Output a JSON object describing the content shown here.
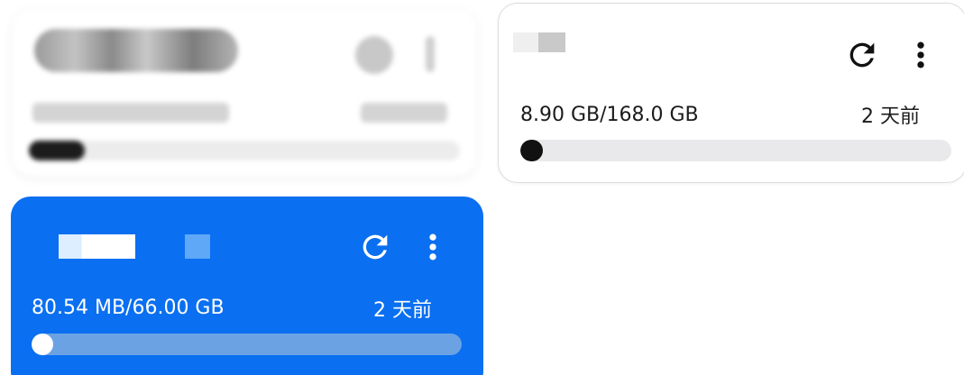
{
  "cards": [
    {
      "id": "storage-card-1",
      "state": "blurred"
    },
    {
      "id": "storage-card-2",
      "usage": "8.90 GB/168.0 GB",
      "updated": "2 天前",
      "progress": 0.053,
      "bar_color": "#e9e9eb",
      "fill_color": "#111111",
      "icon_color": "#111111",
      "refresh_icon": "refresh-icon",
      "more_icon": "more-vertical-icon"
    },
    {
      "id": "storage-card-3",
      "usage": "80.54 MB/66.00 GB",
      "updated": "2 天前",
      "progress": 0.0012,
      "background": "#0a6ff0",
      "bar_color": "#6ba2e4",
      "fill_color": "#ffffff",
      "icon_color": "#ffffff",
      "refresh_icon": "refresh-icon",
      "more_icon": "more-vertical-icon"
    }
  ]
}
